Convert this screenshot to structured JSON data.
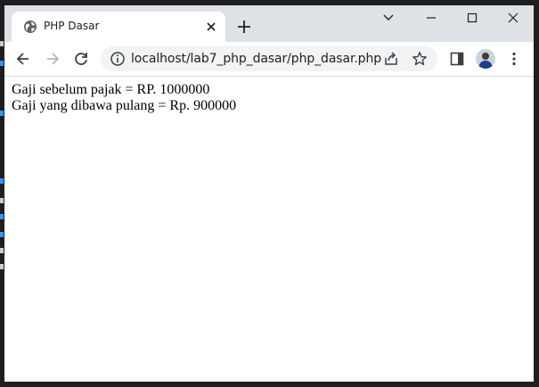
{
  "tab": {
    "title": "PHP Dasar",
    "favicon": "globe-icon"
  },
  "address_bar": {
    "url": "localhost/lab7_php_dasar/php_dasar.php"
  },
  "toolbar_icons": [
    "back-icon",
    "forward-icon",
    "reload-icon",
    "info-icon",
    "share-icon",
    "star-icon",
    "side-panel-icon",
    "profile-avatar",
    "menu-icon"
  ],
  "page": {
    "lines": [
      "Gaji sebelum pajak = RP. 1000000",
      "Gaji yang dibawa pulang = Rp. 900000"
    ]
  },
  "colors": {
    "tabstrip": "#dee1e6",
    "omnibox": "#f1f3f4",
    "icon": "#5f6368"
  }
}
